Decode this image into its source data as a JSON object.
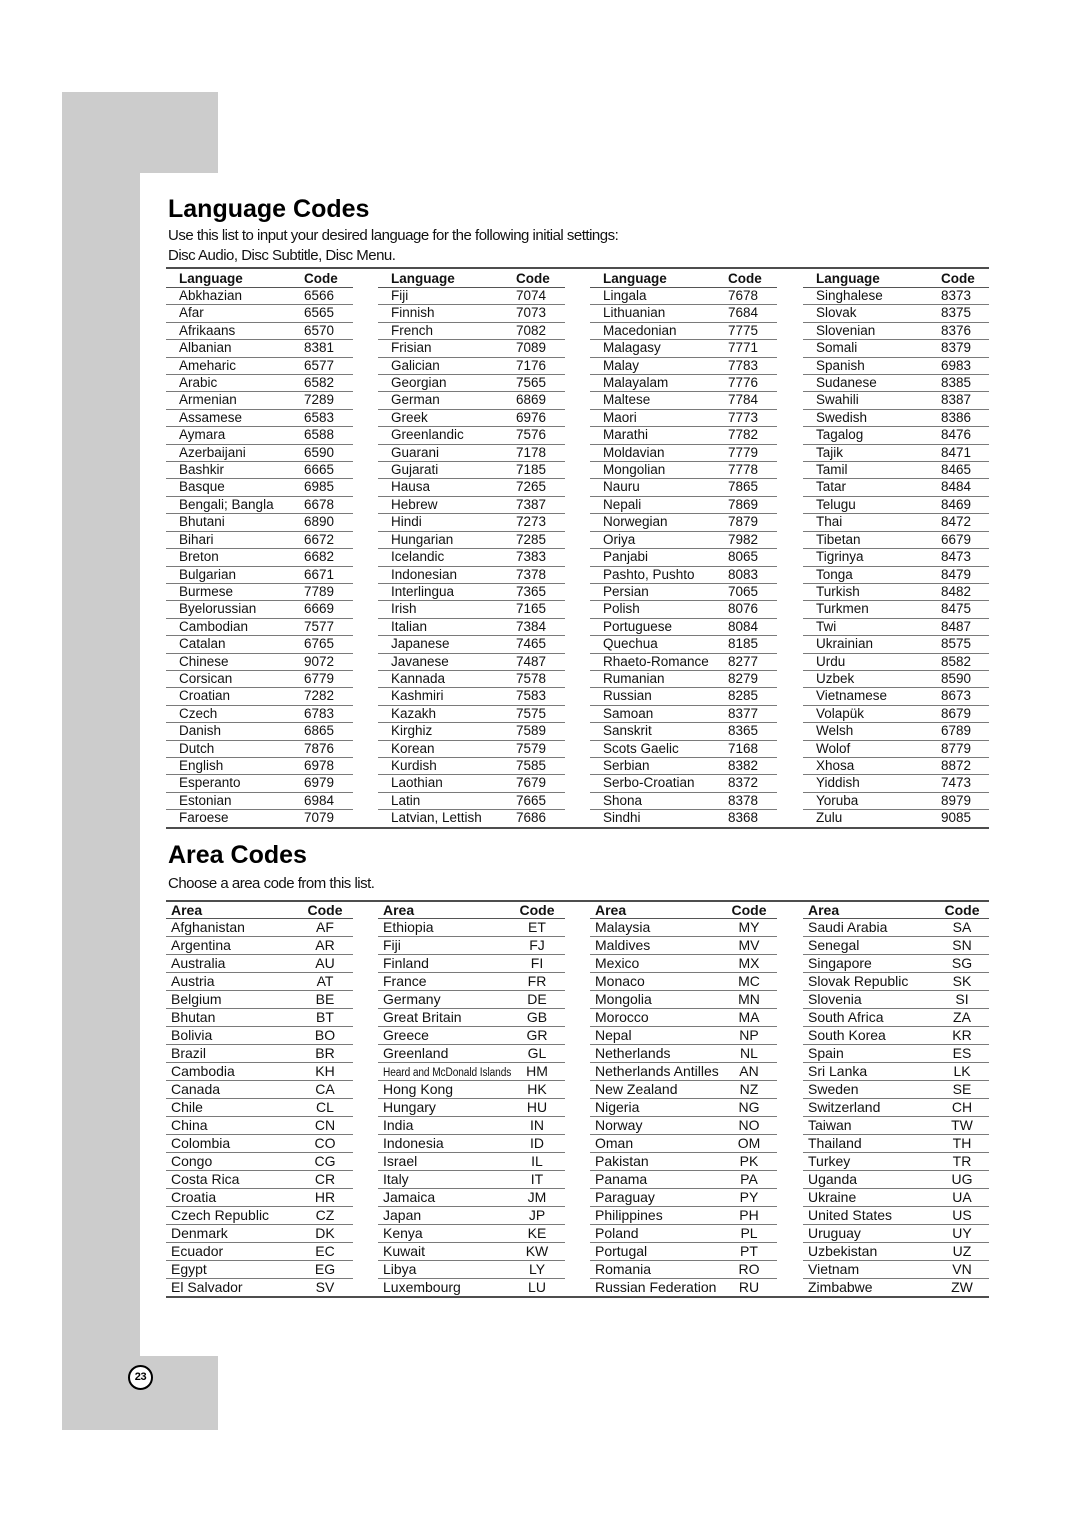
{
  "page_number": "23",
  "language_codes": {
    "title": "Language Codes",
    "intro": [
      "Use this list to input your desired language for the following initial settings:",
      "Disc Audio, Disc Subtitle, Disc Menu."
    ],
    "header": {
      "name": "Language",
      "code": "Code"
    },
    "columns": [
      [
        {
          "name": "Abkhazian",
          "code": "6566"
        },
        {
          "name": "Afar",
          "code": "6565"
        },
        {
          "name": "Afrikaans",
          "code": "6570"
        },
        {
          "name": "Albanian",
          "code": "8381"
        },
        {
          "name": "Ameharic",
          "code": "6577"
        },
        {
          "name": "Arabic",
          "code": "6582"
        },
        {
          "name": "Armenian",
          "code": "7289"
        },
        {
          "name": "Assamese",
          "code": "6583"
        },
        {
          "name": "Aymara",
          "code": "6588"
        },
        {
          "name": "Azerbaijani",
          "code": "6590"
        },
        {
          "name": "Bashkir",
          "code": "6665"
        },
        {
          "name": "Basque",
          "code": "6985"
        },
        {
          "name": "Bengali; Bangla",
          "code": "6678"
        },
        {
          "name": "Bhutani",
          "code": "6890"
        },
        {
          "name": "Bihari",
          "code": "6672"
        },
        {
          "name": "Breton",
          "code": "6682"
        },
        {
          "name": "Bulgarian",
          "code": "6671"
        },
        {
          "name": "Burmese",
          "code": "7789"
        },
        {
          "name": "Byelorussian",
          "code": "6669"
        },
        {
          "name": "Cambodian",
          "code": "7577"
        },
        {
          "name": "Catalan",
          "code": "6765"
        },
        {
          "name": "Chinese",
          "code": "9072"
        },
        {
          "name": "Corsican",
          "code": "6779"
        },
        {
          "name": "Croatian",
          "code": "7282"
        },
        {
          "name": "Czech",
          "code": "6783"
        },
        {
          "name": "Danish",
          "code": "6865"
        },
        {
          "name": "Dutch",
          "code": "7876"
        },
        {
          "name": "English",
          "code": "6978"
        },
        {
          "name": "Esperanto",
          "code": "6979"
        },
        {
          "name": "Estonian",
          "code": "6984"
        },
        {
          "name": "Faroese",
          "code": "7079"
        }
      ],
      [
        {
          "name": "Fiji",
          "code": "7074"
        },
        {
          "name": "Finnish",
          "code": "7073"
        },
        {
          "name": "French",
          "code": "7082"
        },
        {
          "name": "Frisian",
          "code": "7089"
        },
        {
          "name": "Galician",
          "code": "7176"
        },
        {
          "name": "Georgian",
          "code": "7565"
        },
        {
          "name": "German",
          "code": "6869"
        },
        {
          "name": "Greek",
          "code": "6976"
        },
        {
          "name": "Greenlandic",
          "code": "7576"
        },
        {
          "name": "Guarani",
          "code": "7178"
        },
        {
          "name": "Gujarati",
          "code": "7185"
        },
        {
          "name": "Hausa",
          "code": "7265"
        },
        {
          "name": "Hebrew",
          "code": "7387"
        },
        {
          "name": "Hindi",
          "code": "7273"
        },
        {
          "name": "Hungarian",
          "code": "7285"
        },
        {
          "name": "Icelandic",
          "code": "7383"
        },
        {
          "name": "Indonesian",
          "code": "7378"
        },
        {
          "name": "Interlingua",
          "code": "7365"
        },
        {
          "name": "Irish",
          "code": "7165"
        },
        {
          "name": "Italian",
          "code": "7384"
        },
        {
          "name": "Japanese",
          "code": "7465"
        },
        {
          "name": "Javanese",
          "code": "7487"
        },
        {
          "name": "Kannada",
          "code": "7578"
        },
        {
          "name": "Kashmiri",
          "code": "7583"
        },
        {
          "name": "Kazakh",
          "code": "7575"
        },
        {
          "name": "Kirghiz",
          "code": "7589"
        },
        {
          "name": "Korean",
          "code": "7579"
        },
        {
          "name": "Kurdish",
          "code": "7585"
        },
        {
          "name": "Laothian",
          "code": "7679"
        },
        {
          "name": "Latin",
          "code": "7665"
        },
        {
          "name": "Latvian, Lettish",
          "code": "7686"
        }
      ],
      [
        {
          "name": "Lingala",
          "code": "7678"
        },
        {
          "name": "Lithuanian",
          "code": "7684"
        },
        {
          "name": "Macedonian",
          "code": "7775"
        },
        {
          "name": "Malagasy",
          "code": "7771"
        },
        {
          "name": "Malay",
          "code": "7783"
        },
        {
          "name": "Malayalam",
          "code": "7776"
        },
        {
          "name": "Maltese",
          "code": "7784"
        },
        {
          "name": "Maori",
          "code": "7773"
        },
        {
          "name": "Marathi",
          "code": "7782"
        },
        {
          "name": "Moldavian",
          "code": "7779"
        },
        {
          "name": "Mongolian",
          "code": "7778"
        },
        {
          "name": "Nauru",
          "code": "7865"
        },
        {
          "name": "Nepali",
          "code": "7869"
        },
        {
          "name": "Norwegian",
          "code": "7879"
        },
        {
          "name": "Oriya",
          "code": "7982"
        },
        {
          "name": "Panjabi",
          "code": "8065"
        },
        {
          "name": "Pashto, Pushto",
          "code": "8083"
        },
        {
          "name": "Persian",
          "code": "7065"
        },
        {
          "name": "Polish",
          "code": "8076"
        },
        {
          "name": "Portuguese",
          "code": "8084"
        },
        {
          "name": "Quechua",
          "code": "8185"
        },
        {
          "name": "Rhaeto-Romance",
          "code": "8277"
        },
        {
          "name": "Rumanian",
          "code": "8279"
        },
        {
          "name": "Russian",
          "code": "8285"
        },
        {
          "name": "Samoan",
          "code": "8377"
        },
        {
          "name": "Sanskrit",
          "code": "8365"
        },
        {
          "name": "Scots Gaelic",
          "code": "7168"
        },
        {
          "name": "Serbian",
          "code": "8382"
        },
        {
          "name": "Serbo-Croatian",
          "code": "8372"
        },
        {
          "name": "Shona",
          "code": "8378"
        },
        {
          "name": "Sindhi",
          "code": "8368"
        }
      ],
      [
        {
          "name": "Singhalese",
          "code": "8373"
        },
        {
          "name": "Slovak",
          "code": "8375"
        },
        {
          "name": "Slovenian",
          "code": "8376"
        },
        {
          "name": "Somali",
          "code": "8379"
        },
        {
          "name": "Spanish",
          "code": "6983"
        },
        {
          "name": "Sudanese",
          "code": "8385"
        },
        {
          "name": "Swahili",
          "code": "8387"
        },
        {
          "name": "Swedish",
          "code": "8386"
        },
        {
          "name": "Tagalog",
          "code": "8476"
        },
        {
          "name": "Tajik",
          "code": "8471"
        },
        {
          "name": "Tamil",
          "code": "8465"
        },
        {
          "name": "Tatar",
          "code": "8484"
        },
        {
          "name": "Telugu",
          "code": "8469"
        },
        {
          "name": "Thai",
          "code": "8472"
        },
        {
          "name": "Tibetan",
          "code": "6679"
        },
        {
          "name": "Tigrinya",
          "code": "8473"
        },
        {
          "name": "Tonga",
          "code": "8479"
        },
        {
          "name": "Turkish",
          "code": "8482"
        },
        {
          "name": "Turkmen",
          "code": "8475"
        },
        {
          "name": "Twi",
          "code": "8487"
        },
        {
          "name": "Ukrainian",
          "code": "8575"
        },
        {
          "name": "Urdu",
          "code": "8582"
        },
        {
          "name": "Uzbek",
          "code": "8590"
        },
        {
          "name": "Vietnamese",
          "code": "8673"
        },
        {
          "name": "Volapük",
          "code": "8679"
        },
        {
          "name": "Welsh",
          "code": "6789"
        },
        {
          "name": "Wolof",
          "code": "8779"
        },
        {
          "name": "Xhosa",
          "code": "8872"
        },
        {
          "name": "Yiddish",
          "code": "7473"
        },
        {
          "name": "Yoruba",
          "code": "8979"
        },
        {
          "name": "Zulu",
          "code": "9085"
        }
      ]
    ]
  },
  "area_codes": {
    "title": "Area Codes",
    "intro": [
      "Choose a area code from this list."
    ],
    "header": {
      "name": "Area",
      "code": "Code"
    },
    "columns": [
      [
        {
          "name": "Afghanistan",
          "code": "AF"
        },
        {
          "name": "Argentina",
          "code": "AR"
        },
        {
          "name": "Australia",
          "code": "AU"
        },
        {
          "name": "Austria",
          "code": "AT"
        },
        {
          "name": "Belgium",
          "code": "BE"
        },
        {
          "name": "Bhutan",
          "code": "BT"
        },
        {
          "name": "Bolivia",
          "code": "BO"
        },
        {
          "name": "Brazil",
          "code": "BR"
        },
        {
          "name": "Cambodia",
          "code": "KH"
        },
        {
          "name": "Canada",
          "code": "CA"
        },
        {
          "name": "Chile",
          "code": "CL"
        },
        {
          "name": "China",
          "code": "CN"
        },
        {
          "name": "Colombia",
          "code": "CO"
        },
        {
          "name": "Congo",
          "code": "CG"
        },
        {
          "name": "Costa Rica",
          "code": "CR"
        },
        {
          "name": "Croatia",
          "code": "HR"
        },
        {
          "name": "Czech Republic",
          "code": "CZ"
        },
        {
          "name": "Denmark",
          "code": "DK"
        },
        {
          "name": "Ecuador",
          "code": "EC"
        },
        {
          "name": "Egypt",
          "code": "EG"
        },
        {
          "name": "El Salvador",
          "code": "SV"
        }
      ],
      [
        {
          "name": "Ethiopia",
          "code": "ET"
        },
        {
          "name": "Fiji",
          "code": "FJ"
        },
        {
          "name": "Finland",
          "code": "FI"
        },
        {
          "name": "France",
          "code": "FR"
        },
        {
          "name": "Germany",
          "code": "DE"
        },
        {
          "name": "Great Britain",
          "code": "GB"
        },
        {
          "name": "Greece",
          "code": "GR"
        },
        {
          "name": "Greenland",
          "code": "GL"
        },
        {
          "name": "Heard and McDonald Islands",
          "code": "HM"
        },
        {
          "name": "Hong Kong",
          "code": "HK"
        },
        {
          "name": "Hungary",
          "code": "HU"
        },
        {
          "name": "India",
          "code": "IN"
        },
        {
          "name": "Indonesia",
          "code": "ID"
        },
        {
          "name": "Israel",
          "code": "IL"
        },
        {
          "name": "Italy",
          "code": "IT"
        },
        {
          "name": "Jamaica",
          "code": "JM"
        },
        {
          "name": "Japan",
          "code": "JP"
        },
        {
          "name": "Kenya",
          "code": "KE"
        },
        {
          "name": "Kuwait",
          "code": "KW"
        },
        {
          "name": "Libya",
          "code": "LY"
        },
        {
          "name": "Luxembourg",
          "code": "LU"
        }
      ],
      [
        {
          "name": "Malaysia",
          "code": "MY"
        },
        {
          "name": "Maldives",
          "code": "MV"
        },
        {
          "name": "Mexico",
          "code": "MX"
        },
        {
          "name": "Monaco",
          "code": "MC"
        },
        {
          "name": "Mongolia",
          "code": "MN"
        },
        {
          "name": "Morocco",
          "code": "MA"
        },
        {
          "name": "Nepal",
          "code": "NP"
        },
        {
          "name": "Netherlands",
          "code": "NL"
        },
        {
          "name": "Netherlands Antilles",
          "code": "AN"
        },
        {
          "name": "New Zealand",
          "code": "NZ"
        },
        {
          "name": "Nigeria",
          "code": "NG"
        },
        {
          "name": "Norway",
          "code": "NO"
        },
        {
          "name": "Oman",
          "code": "OM"
        },
        {
          "name": "Pakistan",
          "code": "PK"
        },
        {
          "name": "Panama",
          "code": "PA"
        },
        {
          "name": "Paraguay",
          "code": "PY"
        },
        {
          "name": "Philippines",
          "code": "PH"
        },
        {
          "name": "Poland",
          "code": "PL"
        },
        {
          "name": "Portugal",
          "code": "PT"
        },
        {
          "name": "Romania",
          "code": "RO"
        },
        {
          "name": "Russian Federation",
          "code": "RU"
        }
      ],
      [
        {
          "name": "Saudi Arabia",
          "code": "SA"
        },
        {
          "name": "Senegal",
          "code": "SN"
        },
        {
          "name": "Singapore",
          "code": "SG"
        },
        {
          "name": "Slovak Republic",
          "code": "SK"
        },
        {
          "name": "Slovenia",
          "code": "SI"
        },
        {
          "name": "South Africa",
          "code": "ZA"
        },
        {
          "name": "South Korea",
          "code": "KR"
        },
        {
          "name": "Spain",
          "code": "ES"
        },
        {
          "name": "Sri Lanka",
          "code": "LK"
        },
        {
          "name": "Sweden",
          "code": "SE"
        },
        {
          "name": "Switzerland",
          "code": "CH"
        },
        {
          "name": "Taiwan",
          "code": "TW"
        },
        {
          "name": "Thailand",
          "code": "TH"
        },
        {
          "name": "Turkey",
          "code": "TR"
        },
        {
          "name": "Uganda",
          "code": "UG"
        },
        {
          "name": "Ukraine",
          "code": "UA"
        },
        {
          "name": "United States",
          "code": "US"
        },
        {
          "name": "Uruguay",
          "code": "UY"
        },
        {
          "name": "Uzbekistan",
          "code": "UZ"
        },
        {
          "name": "Vietnam",
          "code": "VN"
        },
        {
          "name": "Zimbabwe",
          "code": "ZW"
        }
      ]
    ]
  }
}
